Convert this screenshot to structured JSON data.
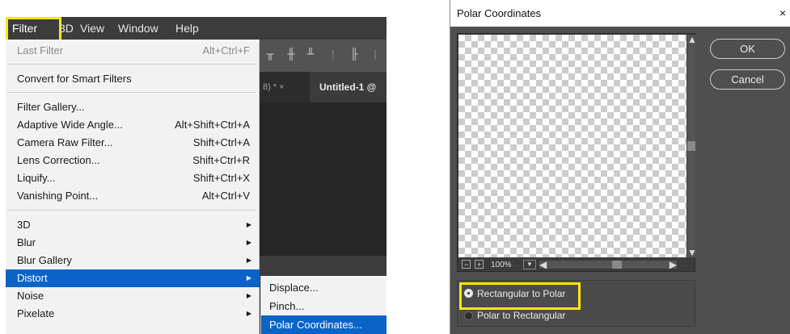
{
  "menubar": {
    "items": [
      "Filter",
      "3D",
      "View",
      "Window",
      "Help"
    ]
  },
  "menu": {
    "items": [
      {
        "label": "Last Filter",
        "shortcut": "Alt+Ctrl+F"
      },
      {
        "label": "Convert for Smart Filters",
        "shortcut": ""
      },
      {
        "label": "Filter Gallery...",
        "shortcut": ""
      },
      {
        "label": "Adaptive Wide Angle...",
        "shortcut": "Alt+Shift+Ctrl+A"
      },
      {
        "label": "Camera Raw Filter...",
        "shortcut": "Shift+Ctrl+A"
      },
      {
        "label": "Lens Correction...",
        "shortcut": "Shift+Ctrl+R"
      },
      {
        "label": "Liquify...",
        "shortcut": "Shift+Ctrl+X"
      },
      {
        "label": "Vanishing Point...",
        "shortcut": "Alt+Ctrl+V"
      },
      {
        "label": "3D",
        "shortcut": ""
      },
      {
        "label": "Blur",
        "shortcut": ""
      },
      {
        "label": "Blur Gallery",
        "shortcut": ""
      },
      {
        "label": "Distort",
        "shortcut": ""
      },
      {
        "label": "Noise",
        "shortcut": ""
      },
      {
        "label": "Pixelate",
        "shortcut": ""
      }
    ]
  },
  "submenu": {
    "items": [
      "Displace...",
      "Pinch...",
      "Polar Coordinates..."
    ]
  },
  "tabs": {
    "prev": "8) *  ×",
    "current": "Untitled-1 @"
  },
  "dialog": {
    "title": "Polar Coordinates",
    "close": "×",
    "ok_label": "OK",
    "cancel_label": "Cancel",
    "zoom": "100%",
    "options": [
      "Rectangular to Polar",
      "Polar to Rectangular"
    ],
    "selected_option": "Rectangular to Polar"
  },
  "colors": {
    "highlight": "#ffe70b",
    "menu_selection": "#0a64c8",
    "ps_dark": "#3c3c3c",
    "dialog_bg": "#4f4f4f"
  }
}
